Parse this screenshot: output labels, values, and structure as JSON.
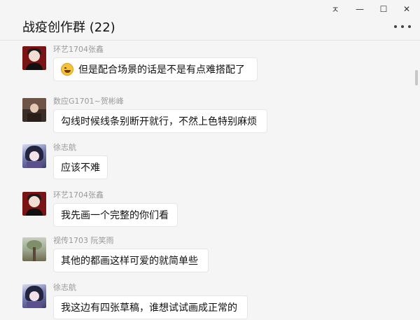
{
  "window": {
    "title": "战疫创作群 (22)",
    "controls": {
      "pin": "ㅈ",
      "minimize": "—",
      "maximize": "☐",
      "close": "✕"
    },
    "more_icon": "more-horizontal-icon"
  },
  "messages": [
    {
      "sender": "环艺1704张鑫",
      "avatar": "red-portrait",
      "has_emoji": true,
      "text": "但是配合场景的话是不是有点难搭配了"
    },
    {
      "sender": "数应G1701~贺彬峰",
      "avatar": "dark-portrait",
      "has_emoji": false,
      "text": "勾线时候线条别断开就行，不然上色特别麻烦"
    },
    {
      "sender": "徐志航",
      "avatar": "anime-portrait",
      "has_emoji": false,
      "text": "应该不难"
    },
    {
      "sender": "环艺1704张鑫",
      "avatar": "red-portrait",
      "has_emoji": false,
      "text": "我先画一个完整的你们看"
    },
    {
      "sender": "视传1703    阮笑雨",
      "avatar": "tree-portrait",
      "has_emoji": false,
      "text": "其他的都画这样可爱的就简单些"
    },
    {
      "sender": "徐志航",
      "avatar": "anime-portrait",
      "has_emoji": false,
      "text": "我这边有四张草稿，谁想试试画成正常的"
    }
  ]
}
